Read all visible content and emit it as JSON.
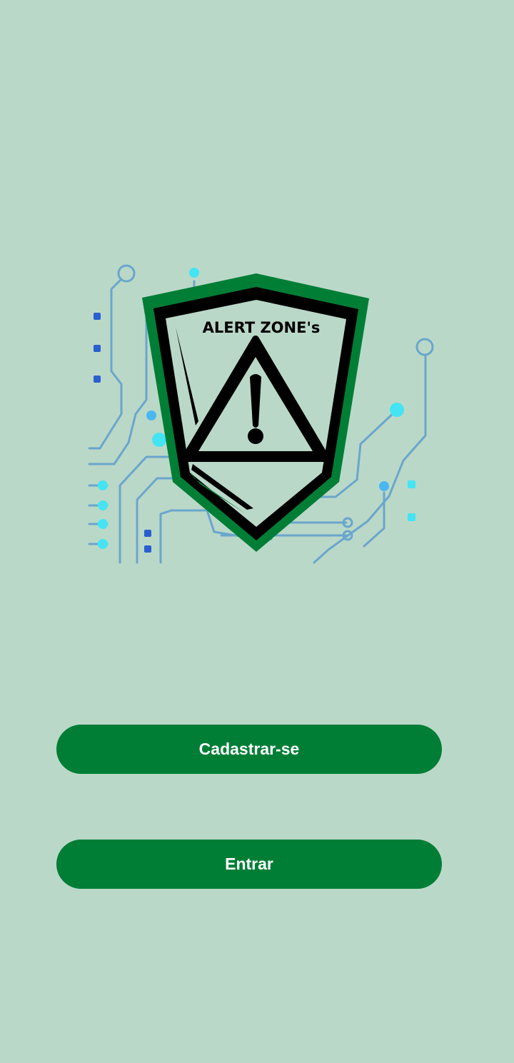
{
  "logo": {
    "title": "ALERT ZONE's",
    "icon": "warning-triangle-icon",
    "colors": {
      "shield_outer": "#007e36",
      "shield_inner": "#000000",
      "circuit": "#6aa6cc",
      "circuit_glow": "#44e4f4"
    }
  },
  "actions": {
    "register_label": "Cadastrar-se",
    "login_label": "Entrar"
  },
  "theme": {
    "background": "#bad8c8",
    "button": "#007e36",
    "button_text": "#ffffff"
  }
}
